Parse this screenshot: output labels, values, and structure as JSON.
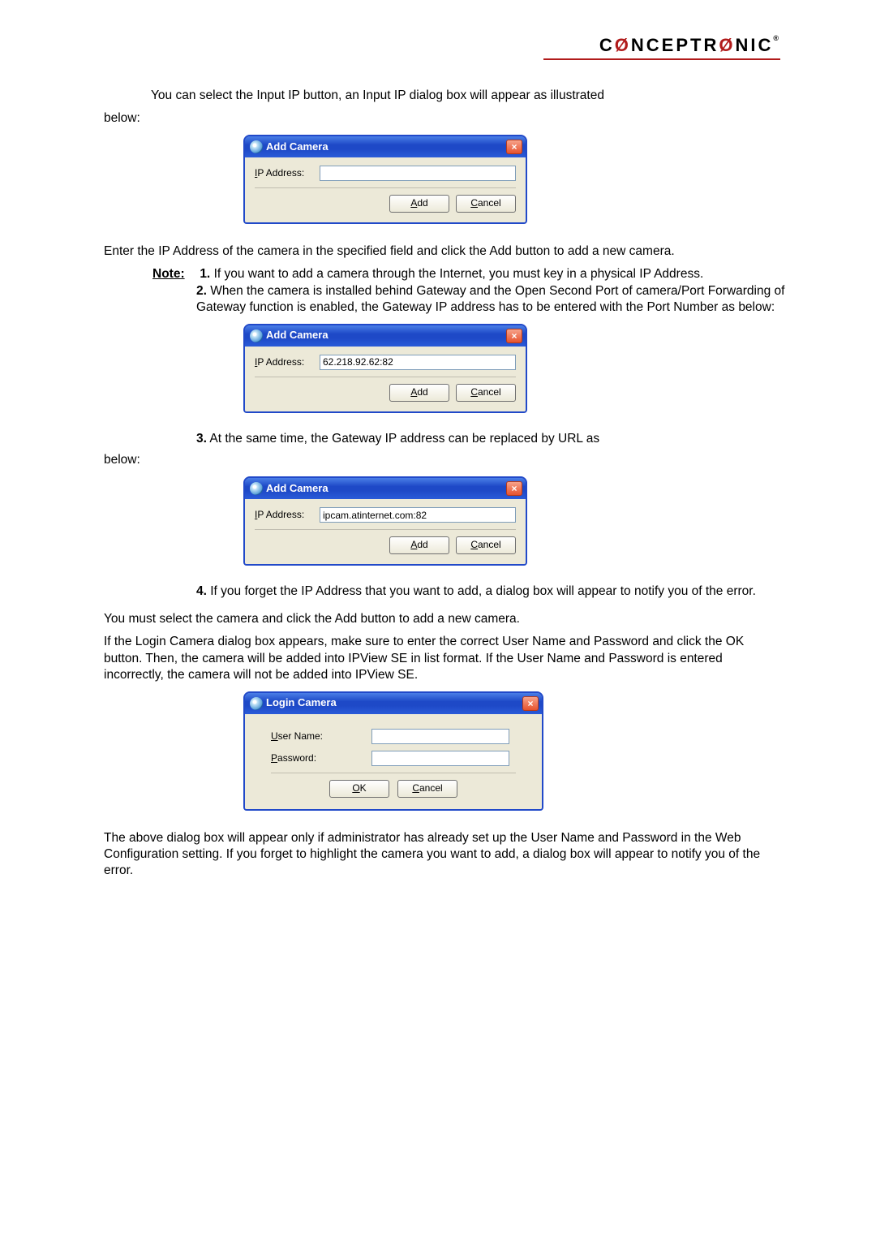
{
  "brand": {
    "name": "CØNCEPTRØNIC",
    "trademark": "®"
  },
  "para1a": "You can select the Input IP button, an Input IP dialog box will appear as illustrated",
  "para1b": "below:",
  "dialog1": {
    "title": "Add Camera",
    "ip_label": "IP Address:",
    "ip_value": "",
    "add": "Add",
    "cancel": "Cancel"
  },
  "para2": "Enter the IP Address of the camera in the specified field and click the Add button to add a new camera.",
  "note": {
    "label": "Note:",
    "n1_num": "1.",
    "n1_text": "If you want to add a camera through the Internet, you must key in a physical IP Address.",
    "n2_num": "2.",
    "n2_text": "When the camera is installed behind Gateway and the Open Second Port of  camera/Port Forwarding of Gateway function is enabled, the Gateway IP address has to be entered with the Port Number as below:"
  },
  "dialog2": {
    "title": "Add Camera",
    "ip_label": "IP Address:",
    "ip_value": "62.218.92.62:82",
    "add": "Add",
    "cancel": "Cancel"
  },
  "note3a_num": "3.",
  "note3a_text": "At the same time, the Gateway IP address can be replaced by URL as",
  "note3b": "below:",
  "dialog3": {
    "title": "Add Camera",
    "ip_label": "IP Address:",
    "ip_value": "ipcam.atinternet.com:82",
    "add": "Add",
    "cancel": "Cancel"
  },
  "note4_num": "4.",
  "note4_text": "If you forget the IP Address that you want to add, a dialog box will appear to notify you of the error.",
  "para3": "You must select the camera and click the  Add button to add a new camera.",
  "para4": "If the Login Camera dialog box appears, make sure to enter the correct User Name and  Password and click the OK button.  Then, the camera will be added into IPView SE in list format. If the User Name and Password is entered incorrectly, the camera will not be added into IPView SE.",
  "login": {
    "title": "Login Camera",
    "user_label": "User Name:",
    "pass_label": "Password:",
    "user_value": "",
    "pass_value": "",
    "ok": "OK",
    "cancel": "Cancel"
  },
  "para5": "The above dialog box will appear only if administrator has already set up the User Name  and Password in the Web Configuration setting. If you forget to highlight the camera you want to add, a dialog box will appear to notify you of the error."
}
